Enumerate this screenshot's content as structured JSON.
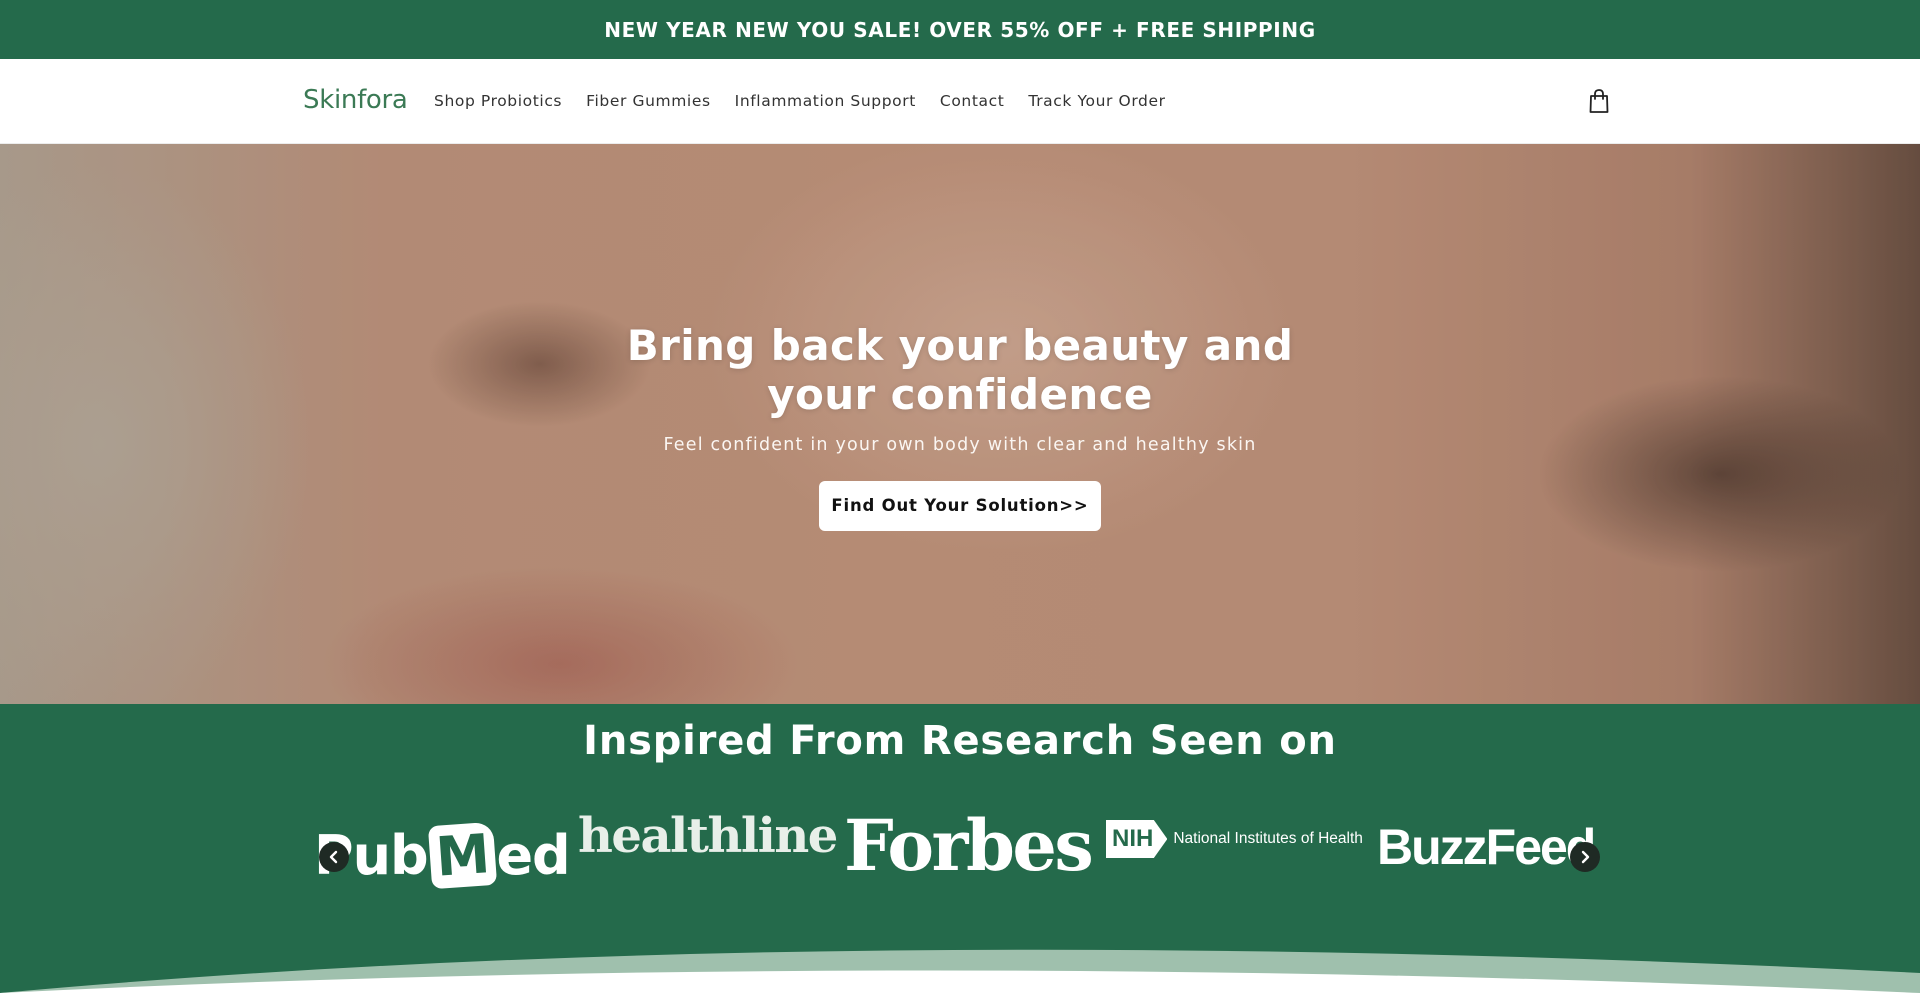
{
  "announcement": {
    "text": "NEW YEAR NEW YOU SALE! OVER 55% OFF + FREE SHIPPING"
  },
  "header": {
    "logo": "Skinfora",
    "nav": [
      "Shop Probiotics",
      "Fiber Gummies",
      "Inflammation Support",
      "Contact",
      "Track Your Order"
    ],
    "cart_icon": "shopping-bag-icon"
  },
  "hero": {
    "title_line1": "Bring back your beauty and",
    "title_line2": "your confidence",
    "subtitle": "Feel confident in your own body with clear and healthy skin",
    "button_label": "Find Out Your Solution>>"
  },
  "press": {
    "title": "Inspired From Research Seen on",
    "logos": {
      "pubmed_pre": "Pub",
      "pubmed_m": "M",
      "pubmed_post": "ed",
      "healthline": "healthline",
      "forbes": "Forbes",
      "nih_badge": "NIH",
      "nih_text": "National Institutes of Health",
      "buzzfeed": "BuzzFeed"
    },
    "prev_icon": "chevron-left-icon",
    "next_icon": "chevron-right-icon"
  },
  "colors": {
    "brand_green": "#246a4b",
    "logo_green": "#3b7a55",
    "button_bg": "#ffffff"
  }
}
